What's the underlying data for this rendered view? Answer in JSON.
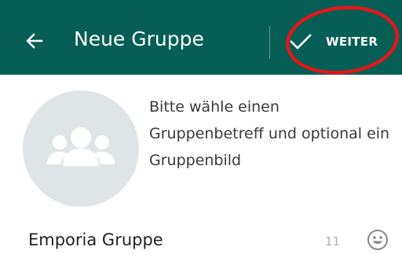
{
  "toolbar": {
    "title": "Neue Gruppe",
    "next_label": "WEITER",
    "back_icon": "arrow-left-icon",
    "next_icon": "check-icon",
    "background_color": "#075e54",
    "highlight_color": "#e0161c"
  },
  "group_photo": {
    "icon": "group-icon",
    "background_color": "#dfe5e7"
  },
  "hint": {
    "text": "Bitte wähle einen Gruppenbetreff und optional ein Gruppenbild"
  },
  "subject": {
    "value": "Emporia Gruppe",
    "remaining_chars": "11",
    "emoji_icon": "smiley-icon"
  }
}
